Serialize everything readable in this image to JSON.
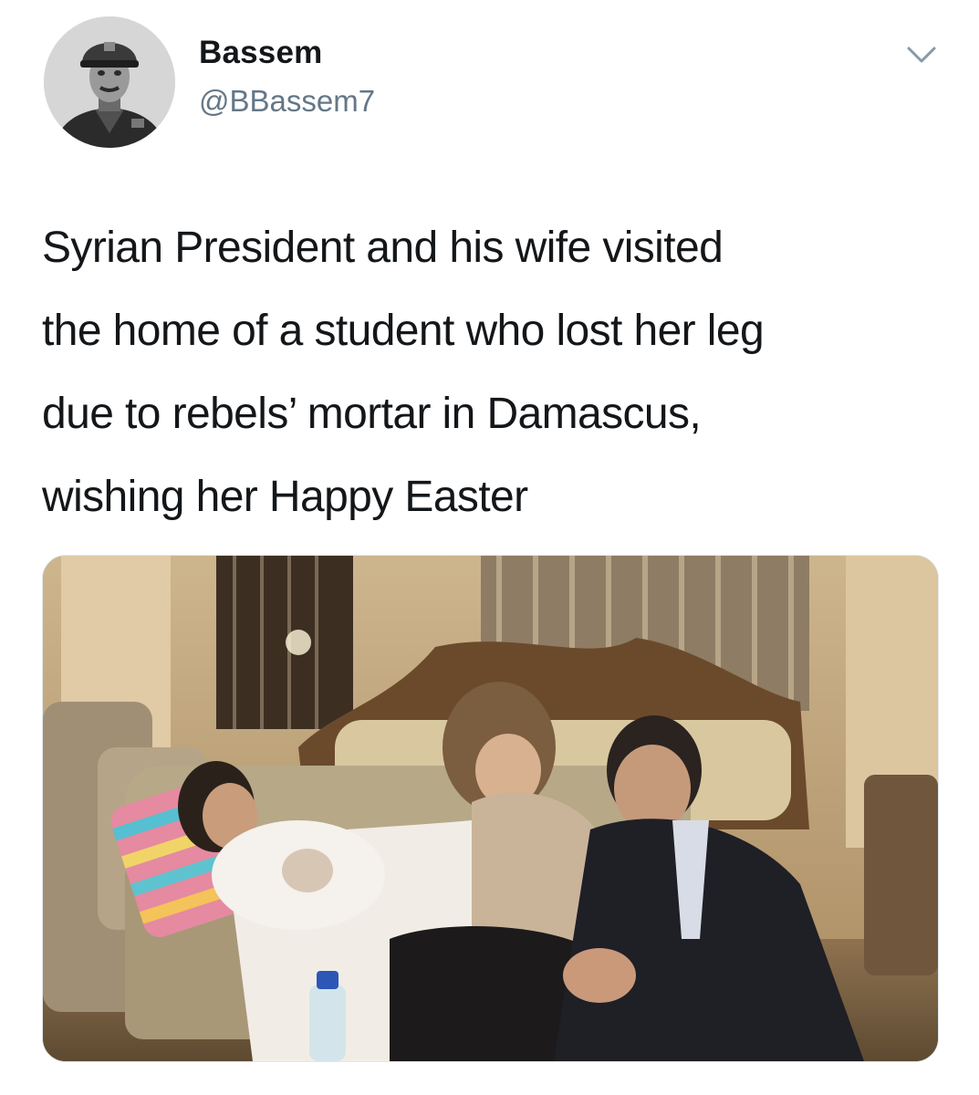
{
  "author": {
    "display_name": "Bassem",
    "handle": "@BBassem7",
    "avatar_icon": "vintage-military-portrait-avatar"
  },
  "header": {
    "menu_icon": "chevron-down-icon"
  },
  "tweet": {
    "text": "Syrian President and his wife visited\nthe home of a student who lost her leg\ndue to rebels’ mortar in Damascus,\nwishing her Happy Easter"
  },
  "media": {
    "type": "photo"
  },
  "colors": {
    "text_primary": "#14171a",
    "text_secondary": "#657786",
    "border": "#e1e8ed"
  }
}
